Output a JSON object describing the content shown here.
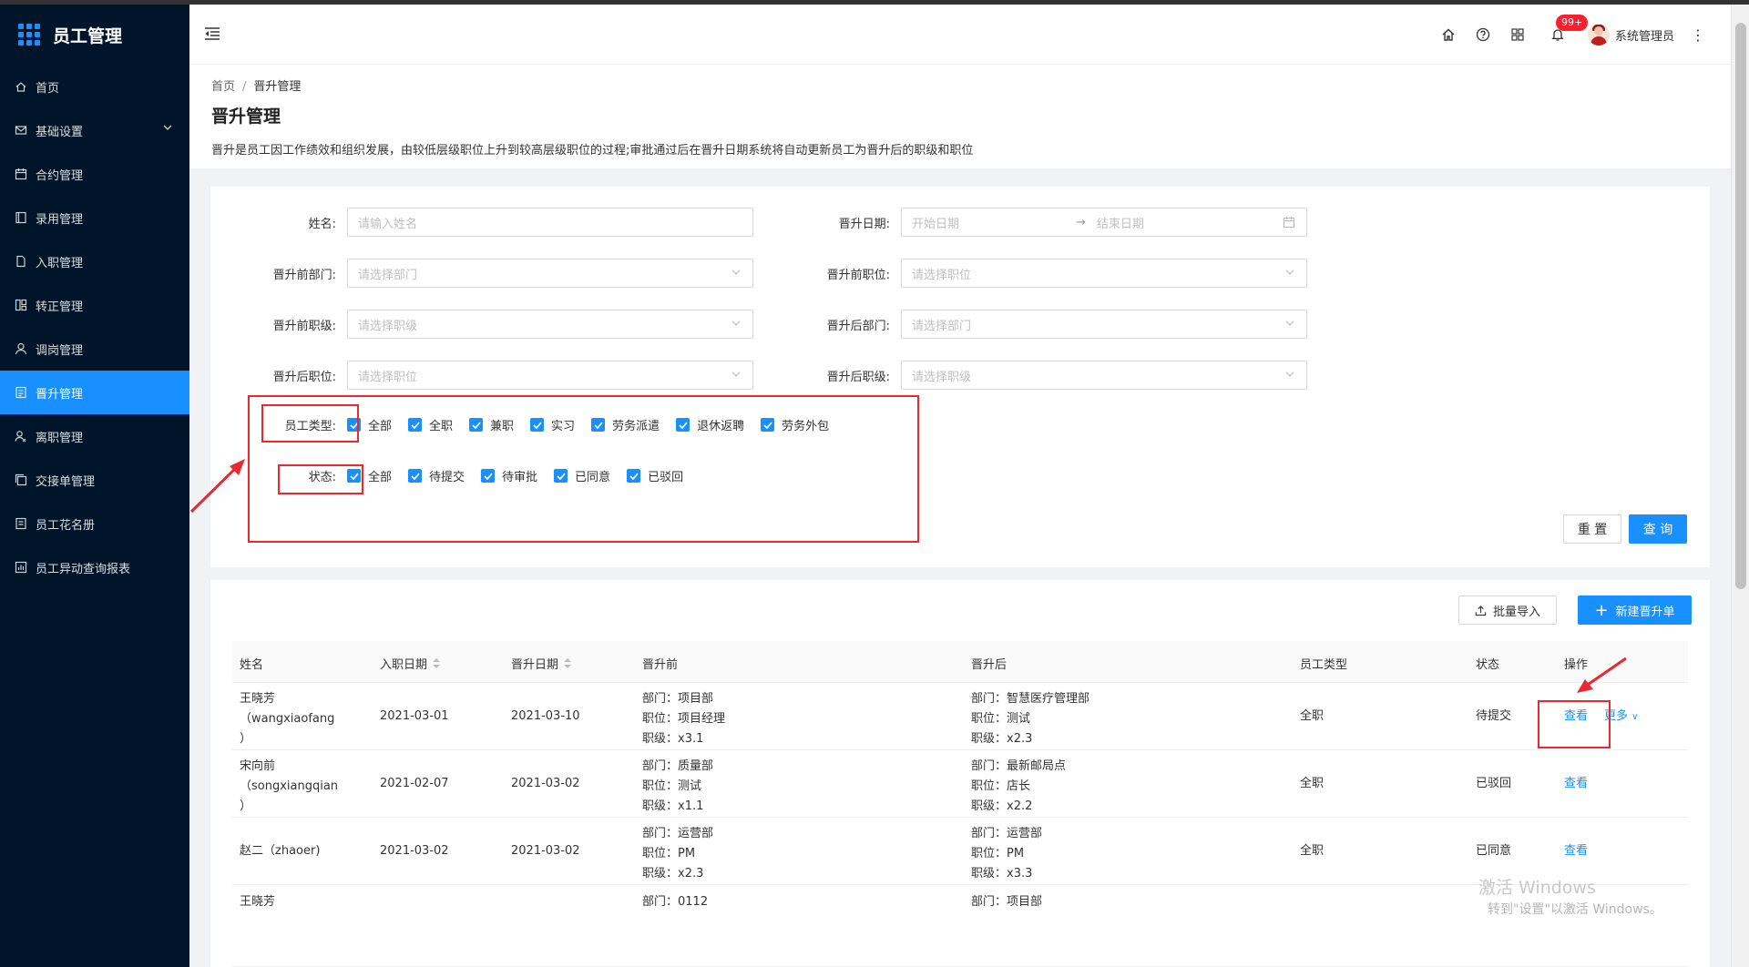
{
  "app": {
    "title": "员工管理"
  },
  "sidebar": {
    "items": [
      {
        "label": "首页",
        "icon": "home-icon"
      },
      {
        "label": "基础设置",
        "icon": "settings-mail-icon"
      },
      {
        "label": "合约管理",
        "icon": "calendar-icon"
      },
      {
        "label": "录用管理",
        "icon": "book-icon"
      },
      {
        "label": "入职管理",
        "icon": "file-icon"
      },
      {
        "label": "转正管理",
        "icon": "columns-icon"
      },
      {
        "label": "调岗管理",
        "icon": "user-icon"
      },
      {
        "label": "晋升管理",
        "icon": "profile-icon"
      },
      {
        "label": "离职管理",
        "icon": "user-leave-icon"
      },
      {
        "label": "交接单管理",
        "icon": "copy-icon"
      },
      {
        "label": "员工花名册",
        "icon": "list-icon"
      },
      {
        "label": "员工异动查询报表",
        "icon": "report-icon"
      }
    ]
  },
  "topbar": {
    "badge": "99+",
    "username": "系统管理员"
  },
  "page": {
    "breadcrumb": [
      "首页",
      "晋升管理"
    ],
    "title": "晋升管理",
    "description": "晋升是员工因工作绩效和组织发展，由较低层级职位上升到较高层级职位的过程;审批通过后在晋升日期系统将自动更新员工为晋升后的职级和职位"
  },
  "filter": {
    "name_label": "姓名:",
    "name_placeholder": "请输入姓名",
    "date_label": "晋升日期:",
    "date_start": "开始日期",
    "date_end": "结束日期",
    "before_dept_label": "晋升前部门:",
    "before_dept_ph": "请选择部门",
    "before_pos_label": "晋升前职位:",
    "before_pos_ph": "请选择职位",
    "before_level_label": "晋升前职级:",
    "before_level_ph": "请选择职级",
    "after_dept_label": "晋升后部门:",
    "after_dept_ph": "请选择部门",
    "after_pos_label": "晋升后职位:",
    "after_pos_ph": "请选择职位",
    "after_level_label": "晋升后职级:",
    "after_level_ph": "请选择职级",
    "emp_type_label": "员工类型:",
    "emp_types": [
      "全部",
      "全职",
      "兼职",
      "实习",
      "劳务派遣",
      "退休返聘",
      "劳务外包"
    ],
    "status_label": "状态:",
    "statuses": [
      "全部",
      "待提交",
      "待审批",
      "已同意",
      "已驳回"
    ],
    "reset": "重 置",
    "search": "查 询"
  },
  "actions": {
    "import": "批量导入",
    "create": "新建晋升单"
  },
  "table": {
    "columns": [
      "姓名",
      "入职日期",
      "晋升日期",
      "晋升前",
      "晋升后",
      "员工类型",
      "状态",
      "操作"
    ],
    "rows": [
      {
        "name1": "王晓芳",
        "name2": "（wangxiaofang",
        "name3": "）",
        "join": "2021-03-01",
        "promo": "2021-03-10",
        "before": [
          "部门：项目部",
          "职位：项目经理",
          "职级：x3.1"
        ],
        "after": [
          "部门：智慧医疗管理部",
          "职位：测试",
          "职级：x2.3"
        ],
        "type": "全职",
        "status": "待提交",
        "view": "查看",
        "more": "更多"
      },
      {
        "name1": "宋向前",
        "name2": "（songxiangqian",
        "name3": "）",
        "join": "2021-02-07",
        "promo": "2021-03-02",
        "before": [
          "部门：质量部",
          "职位：测试",
          "职级：x1.1"
        ],
        "after": [
          "部门：最新邮局点",
          "职位：店长",
          "职级：x2.2"
        ],
        "type": "全职",
        "status": "已驳回",
        "view": "查看",
        "more": ""
      },
      {
        "name1": "赵二（zhaoer)",
        "name2": "",
        "name3": "",
        "join": "2021-03-02",
        "promo": "2021-03-02",
        "before": [
          "部门：运营部",
          "职位：PM",
          "职级：x2.3"
        ],
        "after": [
          "部门：运营部",
          "职位：PM",
          "职级：x3.3"
        ],
        "type": "全职",
        "status": "已同意",
        "view": "查看",
        "more": ""
      },
      {
        "name1": "王晓芳",
        "name2": "",
        "name3": "",
        "join": "",
        "promo": "",
        "before": [
          "部门：0112",
          "",
          ""
        ],
        "after": [
          "部门：项目部",
          "",
          ""
        ],
        "type": "",
        "status": "",
        "view": "",
        "more": ""
      }
    ]
  },
  "watermark": {
    "line1": "激活 Windows",
    "line2": "转到\"设置\"以激活 Windows。"
  },
  "colors": {
    "primary": "#1890ff",
    "sidebar": "#001529",
    "annotation": "#e8292f"
  }
}
